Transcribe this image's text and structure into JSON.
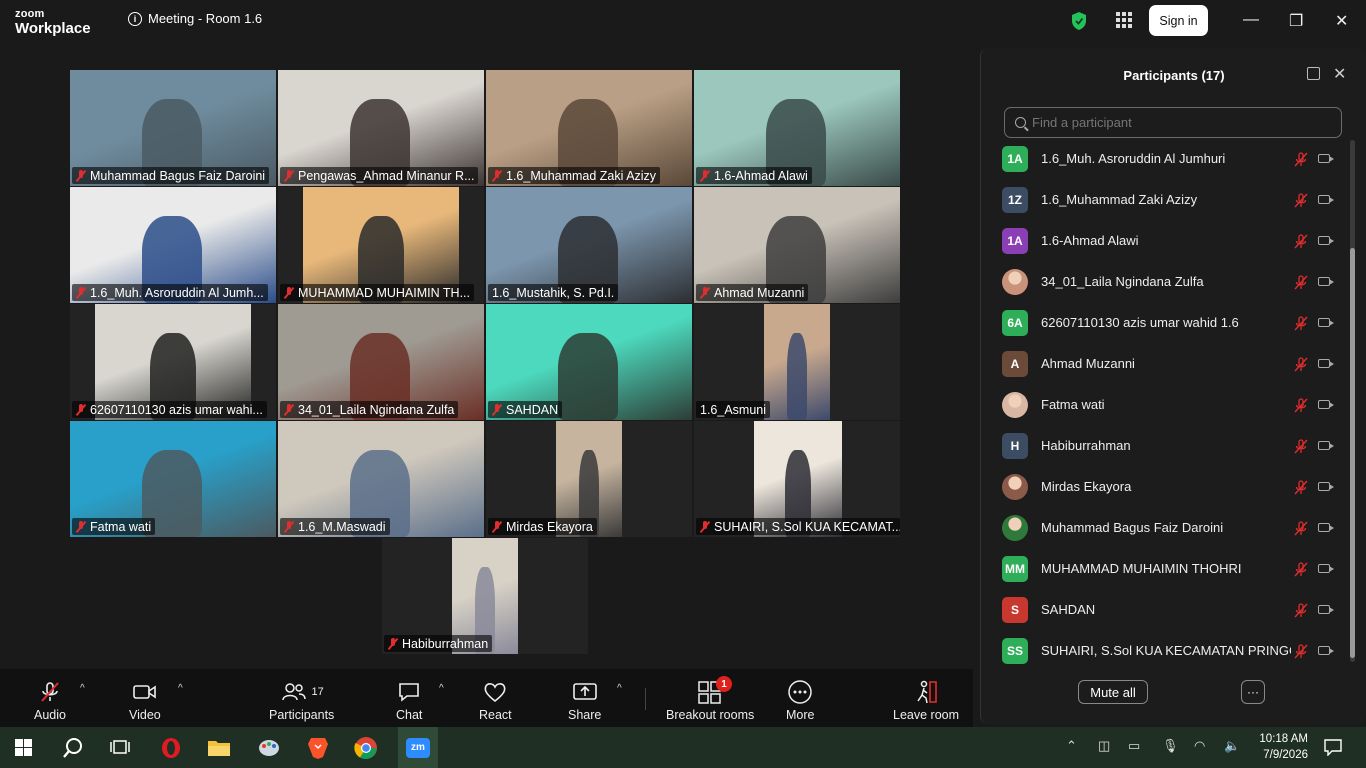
{
  "app": {
    "brand_top": "zoom",
    "brand_bottom": "Workplace",
    "meeting_title": "Meeting - Room 1.6",
    "sign_in": "Sign in"
  },
  "window": {
    "minimize": "—",
    "maximize": "❐",
    "close": "✕"
  },
  "tiles": [
    {
      "name": "Muhammad Bagus Faiz Daroini",
      "muted": true
    },
    {
      "name": "Pengawas_Ahmad Minanur R...",
      "muted": true
    },
    {
      "name": "1.6_Muhammad Zaki Azizy",
      "muted": true
    },
    {
      "name": "1.6-Ahmad Alawi",
      "muted": true
    },
    {
      "name": "1.6_Muh. Asroruddin Al Jumh...",
      "muted": true
    },
    {
      "name": "MUHAMMAD MUHAIMIN TH...",
      "muted": true
    },
    {
      "name": "1.6_Mustahik, S. Pd.I.",
      "muted": false
    },
    {
      "name": "Ahmad Muzanni",
      "muted": true
    },
    {
      "name": "62607110130 azis umar wahi...",
      "muted": true
    },
    {
      "name": "34_01_Laila Ngindana Zulfa",
      "muted": true
    },
    {
      "name": "SAHDAN",
      "muted": true
    },
    {
      "name": "1.6_Asmuni",
      "muted": false
    },
    {
      "name": "Fatma wati",
      "muted": true
    },
    {
      "name": "1.6_M.Maswadi",
      "muted": true
    },
    {
      "name": "Mirdas Ekayora",
      "muted": true
    },
    {
      "name": "SUHAIRI, S.Sol KUA KECAMAT...",
      "muted": true
    },
    {
      "name": "Habiburrahman",
      "muted": true
    }
  ],
  "panel": {
    "title": "Participants (17)",
    "search_placeholder": "Find a participant",
    "mute_all": "Mute all",
    "more": "···",
    "participants": [
      {
        "initials": "1A",
        "color": "#2fae5a",
        "name": "1.6_Muh. Asroruddin Al Jumhuri"
      },
      {
        "initials": "1Z",
        "color": "#3c4c63",
        "name": "1.6_Muhammad Zaki Azizy"
      },
      {
        "initials": "1A",
        "color": "#8a3fb5",
        "name": "1.6-Ahmad Alawi"
      },
      {
        "initials": "",
        "color": "#c9927a",
        "name": "34_01_Laila Ngindana Zulfa"
      },
      {
        "initials": "6A",
        "color": "#2fae5a",
        "name": "62607110130 azis umar wahid 1.6"
      },
      {
        "initials": "A",
        "color": "#6b4a3a",
        "name": "Ahmad Muzanni"
      },
      {
        "initials": "",
        "color": "#d8b7a4",
        "name": "Fatma wati"
      },
      {
        "initials": "H",
        "color": "#3c4c63",
        "name": "Habiburrahman"
      },
      {
        "initials": "",
        "color": "#8b5a4a",
        "name": "Mirdas Ekayora"
      },
      {
        "initials": "",
        "color": "#2f7a3a",
        "name": "Muhammad Bagus Faiz Daroini"
      },
      {
        "initials": "MM",
        "color": "#2fae5a",
        "name": "MUHAMMAD MUHAIMIN THOHRI"
      },
      {
        "initials": "S",
        "color": "#c9382f",
        "name": "SAHDAN"
      },
      {
        "initials": "SS",
        "color": "#2fae5a",
        "name": "SUHAIRI, S.Sol KUA KECAMATAN PRINGG..."
      }
    ]
  },
  "toolbar": {
    "audio": "Audio",
    "video": "Video",
    "participants": "Participants",
    "participants_count": "17",
    "chat": "Chat",
    "react": "React",
    "share": "Share",
    "breakout": "Breakout rooms",
    "breakout_badge": "1",
    "more": "More",
    "leave": "Leave room"
  },
  "taskbar": {
    "time": "10:18 AM",
    "date": "7/9/2026"
  },
  "colors": {
    "accent_green": "#25c15b",
    "danger_red": "#e02d2d"
  }
}
